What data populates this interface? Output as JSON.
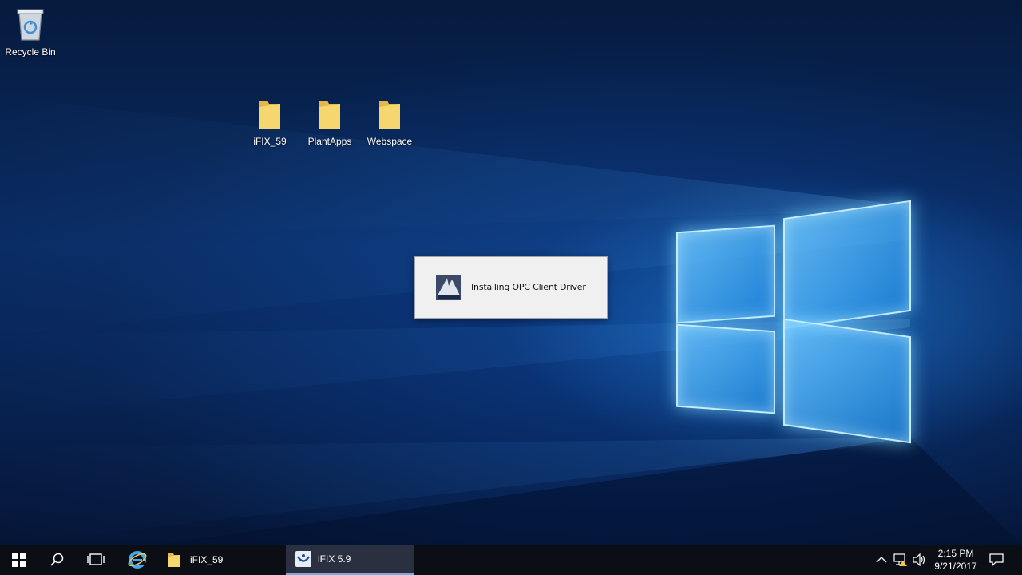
{
  "desktop": {
    "icons": [
      {
        "label": "Recycle Bin",
        "icon": "recycle-bin-icon"
      },
      {
        "label": "iFIX_59",
        "icon": "folder-icon"
      },
      {
        "label": "PlantApps",
        "icon": "folder-icon"
      },
      {
        "label": "Webspace",
        "icon": "folder-icon"
      }
    ]
  },
  "dialog": {
    "message": "Installing OPC Client Driver",
    "icon": "ifix-installer-icon"
  },
  "taskbar": {
    "start": "windows-start-icon",
    "search": "search-icon",
    "task_view": "task-view-icon",
    "browser": "internet-explorer-icon",
    "apps": [
      {
        "label": "iFIX_59",
        "icon": "folder-icon",
        "active": false
      },
      {
        "label": "iFIX 5.9",
        "icon": "ifix-icon",
        "active": true
      }
    ],
    "tray": {
      "icons": [
        "chevron-up-icon",
        "network-icon",
        "volume-icon",
        "notifications-icon"
      ],
      "time": "2:15 PM",
      "date": "9/21/2017"
    }
  },
  "colors": {
    "desktop_top": "#061a3d",
    "desktop_glow": "#2a8ce6",
    "taskbar": "#0b0e14",
    "active_app": "#2b3040",
    "folder": "#f4d36b"
  }
}
